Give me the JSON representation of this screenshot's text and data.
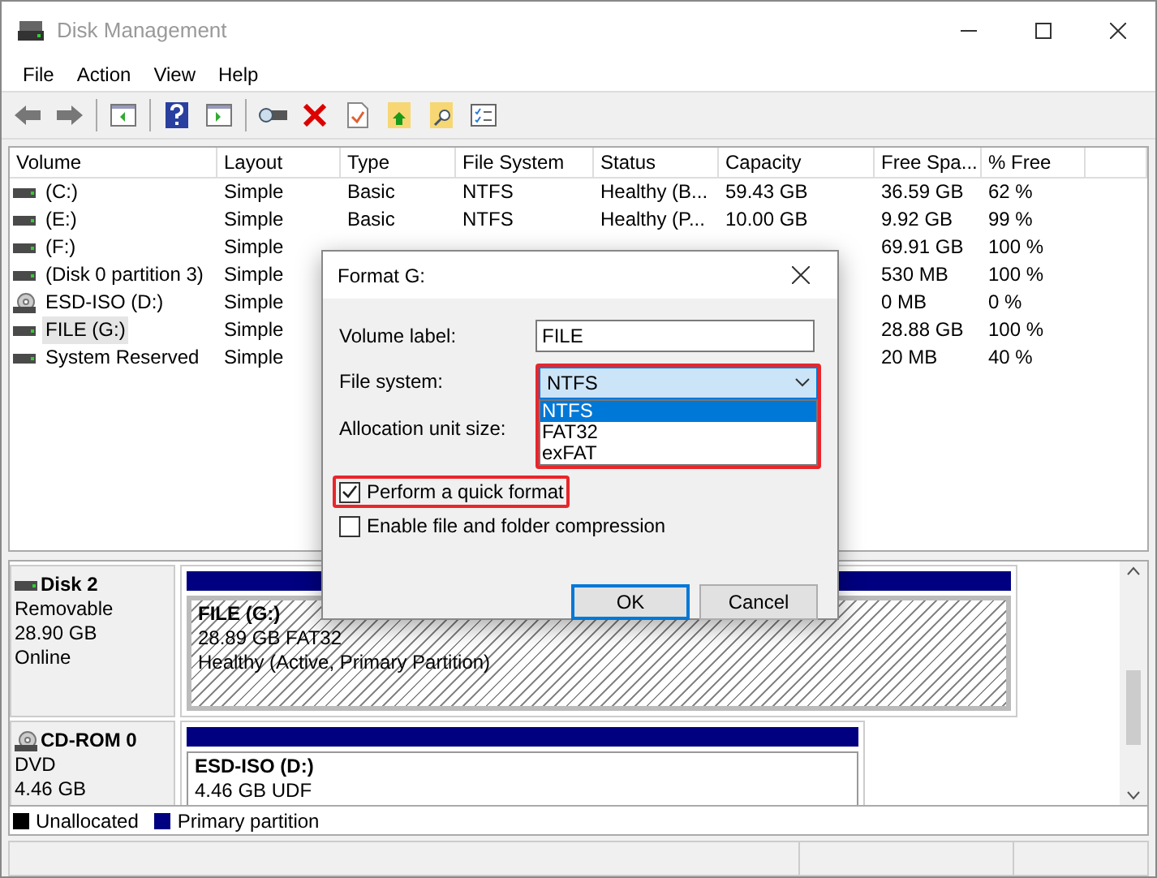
{
  "window": {
    "title": "Disk Management"
  },
  "menu": [
    "File",
    "Action",
    "View",
    "Help"
  ],
  "volumes": {
    "columns": [
      "Volume",
      "Layout",
      "Type",
      "File System",
      "Status",
      "Capacity",
      "Free Spa...",
      "% Free"
    ],
    "rows": [
      {
        "kind": "disk",
        "selected": false,
        "cells": [
          "(C:)",
          "Simple",
          "Basic",
          "NTFS",
          "Healthy (B...",
          "59.43 GB",
          "36.59 GB",
          "62 %"
        ]
      },
      {
        "kind": "disk",
        "selected": false,
        "cells": [
          "(E:)",
          "Simple",
          "Basic",
          "NTFS",
          "Healthy (P...",
          "10.00 GB",
          "9.92 GB",
          "99 %"
        ]
      },
      {
        "kind": "disk",
        "selected": false,
        "cells": [
          "(F:)",
          "Simple",
          null,
          null,
          null,
          null,
          "69.91 GB",
          "100 %"
        ]
      },
      {
        "kind": "disk",
        "selected": false,
        "cells": [
          "(Disk 0 partition 3)",
          "Simple",
          null,
          null,
          null,
          null,
          "530 MB",
          "100 %"
        ]
      },
      {
        "kind": "cdrom",
        "selected": false,
        "cells": [
          "ESD-ISO (D:)",
          "Simple",
          null,
          null,
          null,
          null,
          "0 MB",
          "0 %"
        ]
      },
      {
        "kind": "disk",
        "selected": true,
        "cells": [
          "FILE (G:)",
          "Simple",
          null,
          null,
          null,
          null,
          "28.88 GB",
          "100 %"
        ]
      },
      {
        "kind": "disk",
        "selected": false,
        "cells": [
          "System Reserved",
          "Simple",
          null,
          null,
          null,
          null,
          "20 MB",
          "40 %"
        ]
      }
    ]
  },
  "disks": [
    {
      "kind": "disk",
      "name": "Disk 2",
      "lines": [
        "Removable",
        "28.90 GB",
        "Online"
      ],
      "volumes": [
        {
          "name": "FILE  (G:)",
          "lines": [
            "28.89 GB FAT32",
            "Healthy (Active, Primary Partition)"
          ],
          "selected": true
        }
      ]
    },
    {
      "kind": "cdrom",
      "name": "CD-ROM 0",
      "lines": [
        "DVD",
        "4.46 GB"
      ],
      "volumes": [
        {
          "name": "ESD-ISO  (D:)",
          "lines": [
            "4.46 GB UDF"
          ],
          "selected": false
        }
      ]
    }
  ],
  "legend": [
    {
      "label": "Unallocated",
      "color": "#000000"
    },
    {
      "label": "Primary partition",
      "color": "#000080"
    }
  ],
  "dialog": {
    "title": "Format G:",
    "volume_label": {
      "label": "Volume label:",
      "value": "FILE"
    },
    "file_system": {
      "label": "File system:",
      "value": "NTFS",
      "expanded": true,
      "highlighted": true,
      "options": [
        {
          "label": "NTFS",
          "selected": true
        },
        {
          "label": "FAT32",
          "selected": false
        },
        {
          "label": "exFAT",
          "selected": false
        }
      ]
    },
    "allocation_unit_size": {
      "label": "Allocation unit size:"
    },
    "checkboxes": [
      {
        "label": "Perform a quick format",
        "checked": true,
        "highlighted": true
      },
      {
        "label": "Enable file and folder compression",
        "checked": false,
        "highlighted": false
      }
    ],
    "buttons": [
      {
        "label": "OK",
        "default": true
      },
      {
        "label": "Cancel",
        "default": false
      }
    ]
  }
}
